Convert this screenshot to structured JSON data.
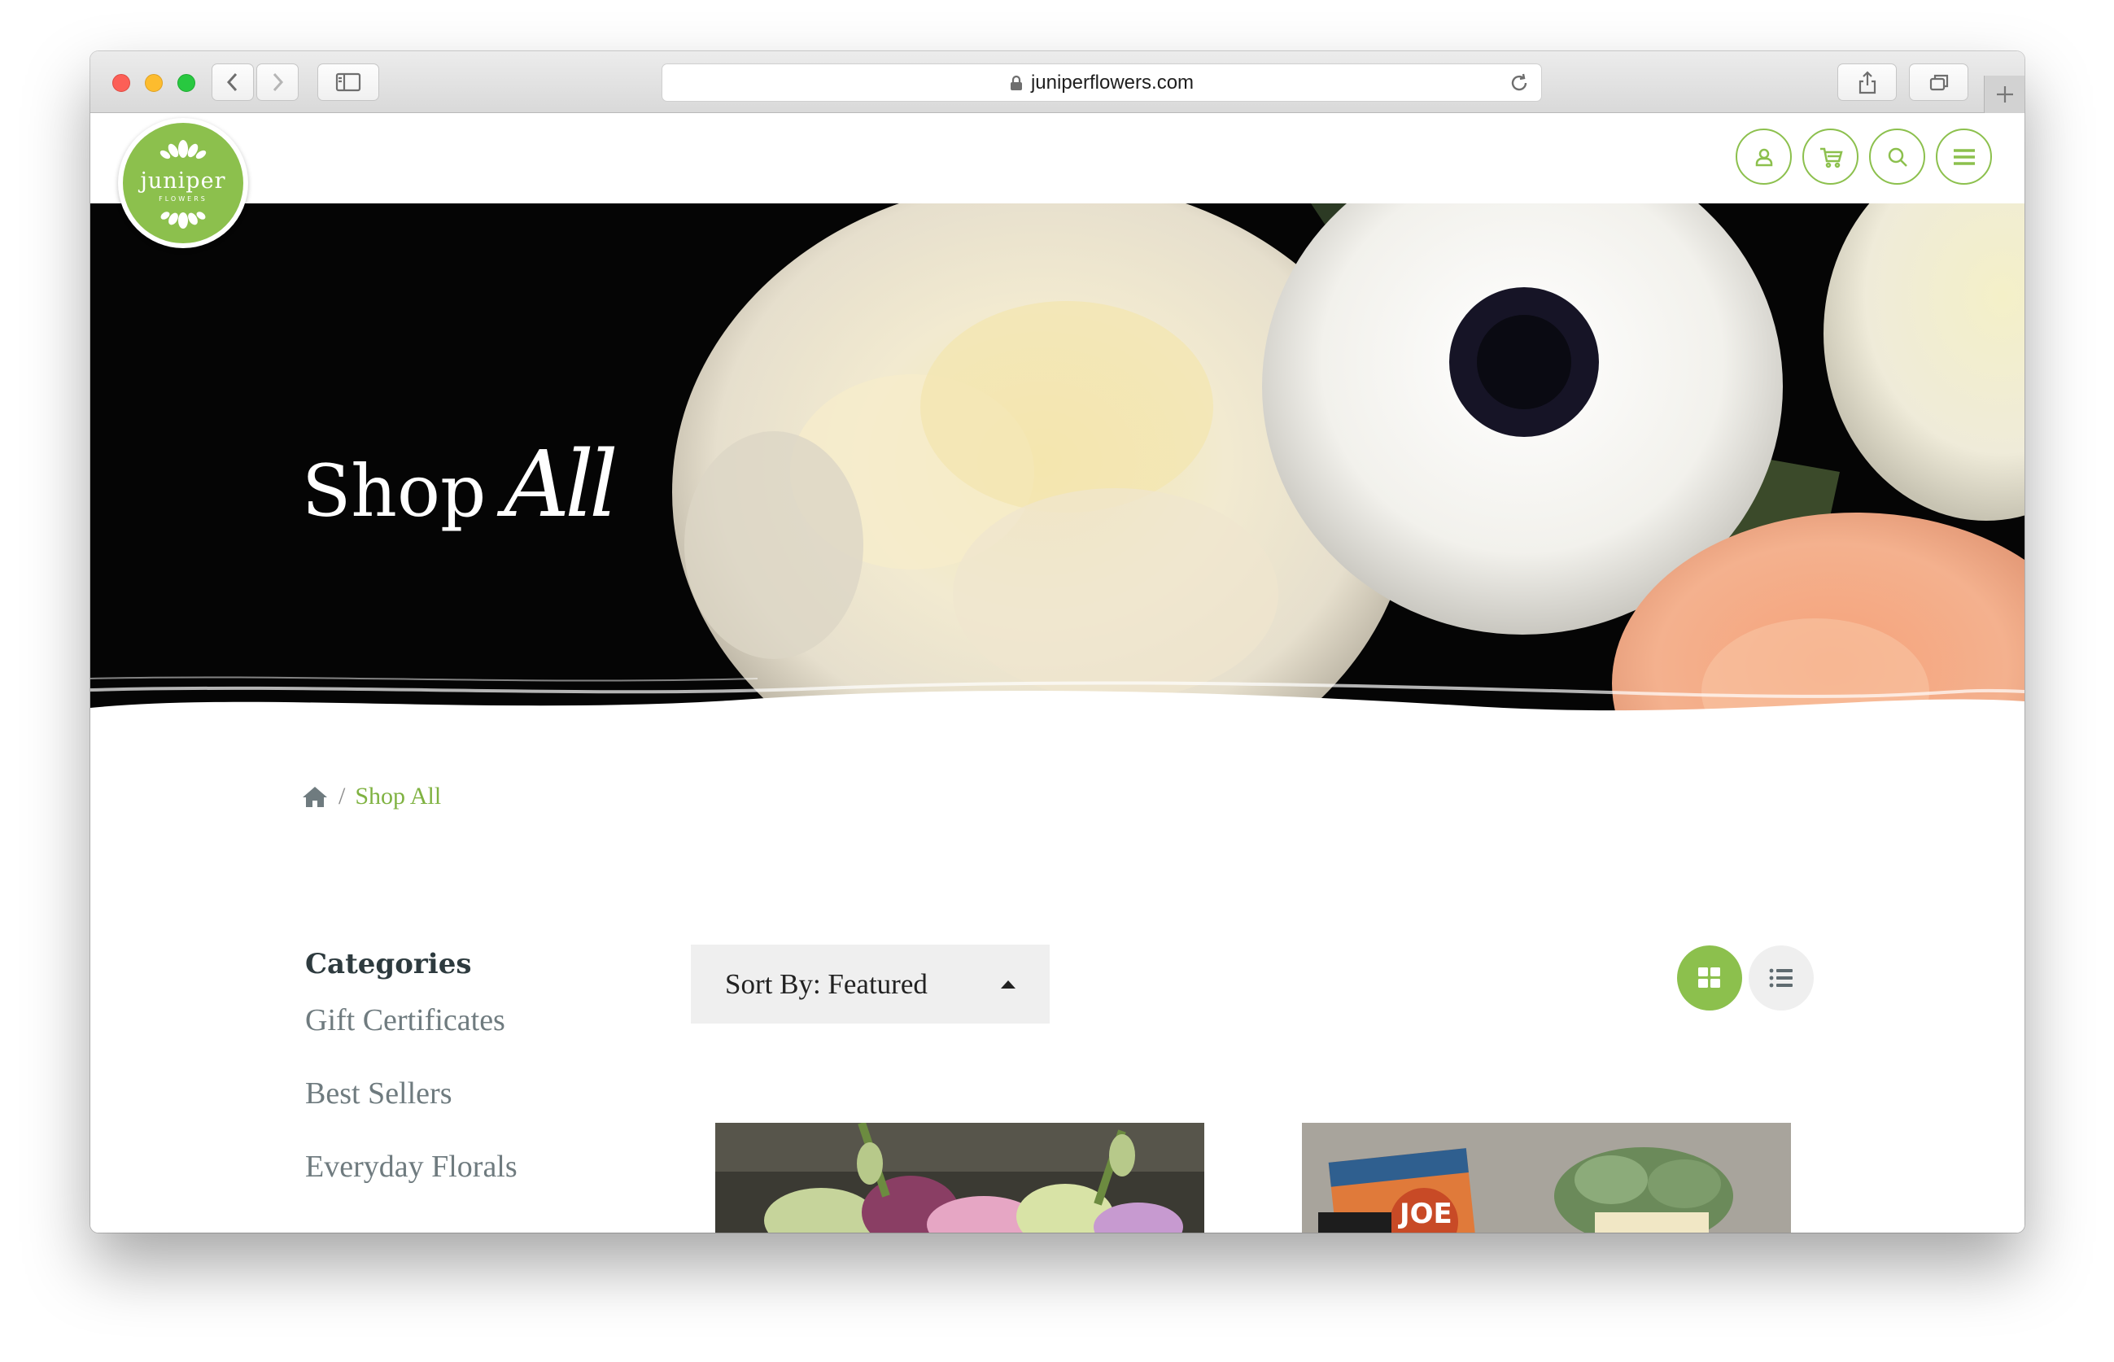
{
  "browser": {
    "url": "juniperflowers.com"
  },
  "site": {
    "logo": {
      "word": "juniper",
      "sub": "FLOWERS"
    },
    "header_icons": [
      "account-icon",
      "cart-icon",
      "search-icon",
      "menu-icon"
    ]
  },
  "hero": {
    "title_plain": "Shop",
    "title_script": "All"
  },
  "breadcrumb": {
    "separator": "/",
    "current": "Shop All"
  },
  "sidebar": {
    "heading": "Categories",
    "categories": [
      {
        "label": "Gift Certificates"
      },
      {
        "label": "Best Sellers"
      },
      {
        "label": "Everyday Florals"
      }
    ]
  },
  "toolbar": {
    "sort_label": "Sort By: Featured",
    "view_modes": [
      "grid",
      "list"
    ],
    "active_view": "grid"
  },
  "products": [
    {
      "image": "floral-arrangement-photo"
    },
    {
      "image": "gift-box-succulent-photo",
      "label_text": "JOE"
    }
  ],
  "colors": {
    "brand_green": "#8cc04d",
    "breadcrumb_green": "#7fb241",
    "text_dark": "#2e3b3f",
    "text_muted": "#6f7b7f",
    "hero_background": "#050505"
  }
}
